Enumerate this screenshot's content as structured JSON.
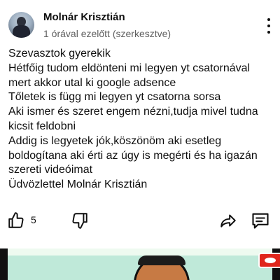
{
  "post": {
    "author": "Molnár Krisztián",
    "meta": "1 órával ezelőtt (szerkesztve)",
    "lines": [
      "Szevasztok gyerekik",
      "Hétfőig tudom eldönteni mi legyen yt csatornával",
      "mert akkor utal ki google adsence",
      "Tőletek is függ mi legyen yt csatorna sorsa",
      "Aki ismer és szeret engem nézni,tudja mivel tudna",
      "kicsit feldobni",
      "Addig is legyetek jók,köszönöm aki esetleg",
      "boldogítana aki érti az úgy is megérti és ha igazán",
      "szereti videóimat",
      "Üdvözlettel Molnár Krisztián"
    ]
  },
  "actions": {
    "like_count": "5",
    "icons": [
      "thumbs-up-icon",
      "thumbs-down-icon",
      "share-icon",
      "comment-icon",
      "more-vertical-icon"
    ]
  },
  "colors": {
    "text": "#0f0f0f",
    "meta": "#606060",
    "background": "#ffffff"
  }
}
